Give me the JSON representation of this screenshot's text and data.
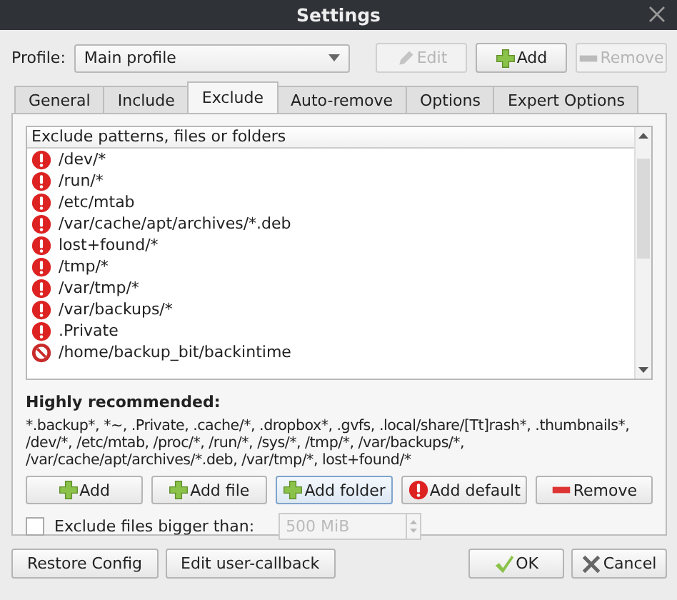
{
  "window": {
    "title": "Settings"
  },
  "profile": {
    "label": "Profile:",
    "value": "Main profile"
  },
  "profile_buttons": [
    {
      "label": "Edit",
      "kind": "edit",
      "disabled": true
    },
    {
      "label": "Add",
      "kind": "add",
      "disabled": false
    },
    {
      "label": "Remove",
      "kind": "remove",
      "disabled": true
    }
  ],
  "tabs": [
    {
      "label": "General",
      "selected": false
    },
    {
      "label": "Include",
      "selected": false
    },
    {
      "label": "Exclude",
      "selected": true
    },
    {
      "label": "Auto-remove",
      "selected": false
    },
    {
      "label": "Options",
      "selected": false
    },
    {
      "label": "Expert Options",
      "selected": false
    }
  ],
  "exclude_list": {
    "header": "Exclude patterns, files or folders",
    "items": [
      {
        "text": "/dev/*",
        "kind": "warning"
      },
      {
        "text": "/run/*",
        "kind": "warning"
      },
      {
        "text": "/etc/mtab",
        "kind": "warning"
      },
      {
        "text": "/var/cache/apt/archives/*.deb",
        "kind": "warning"
      },
      {
        "text": "lost+found/*",
        "kind": "warning"
      },
      {
        "text": "/tmp/*",
        "kind": "warning"
      },
      {
        "text": "/var/tmp/*",
        "kind": "warning"
      },
      {
        "text": "/var/backups/*",
        "kind": "warning"
      },
      {
        "text": ".Private",
        "kind": "warning"
      },
      {
        "text": "/home/backup_bit/backintime",
        "kind": "blocked"
      }
    ]
  },
  "recommended": {
    "heading": "Highly recommended:",
    "text": "*.backup*, *~, .Private, .cache/*, .dropbox*, .gvfs, .local/share/[Tt]rash*, .thumbnails*, /dev/*, /etc/mtab, /proc/*, /run/*, /sys/*, /tmp/*, /var/backups/*, /var/cache/apt/archives/*.deb, /var/tmp/*, lost+found/*"
  },
  "action_buttons": [
    {
      "label": "Add",
      "kind": "add",
      "focused": false
    },
    {
      "label": "Add file",
      "kind": "add",
      "focused": false
    },
    {
      "label": "Add folder",
      "kind": "add",
      "focused": true
    },
    {
      "label": "Add default",
      "kind": "warning",
      "focused": false
    },
    {
      "label": "Remove",
      "kind": "remove",
      "focused": false
    }
  ],
  "size_limit": {
    "label": "Exclude files bigger than:",
    "checked": false,
    "value": "500 MiB",
    "disabled": true
  },
  "footer_left": [
    {
      "label": "Restore Config"
    },
    {
      "label": "Edit user-callback"
    }
  ],
  "footer_right": [
    {
      "label": "OK",
      "kind": "ok"
    },
    {
      "label": "Cancel",
      "kind": "cancel"
    }
  ]
}
